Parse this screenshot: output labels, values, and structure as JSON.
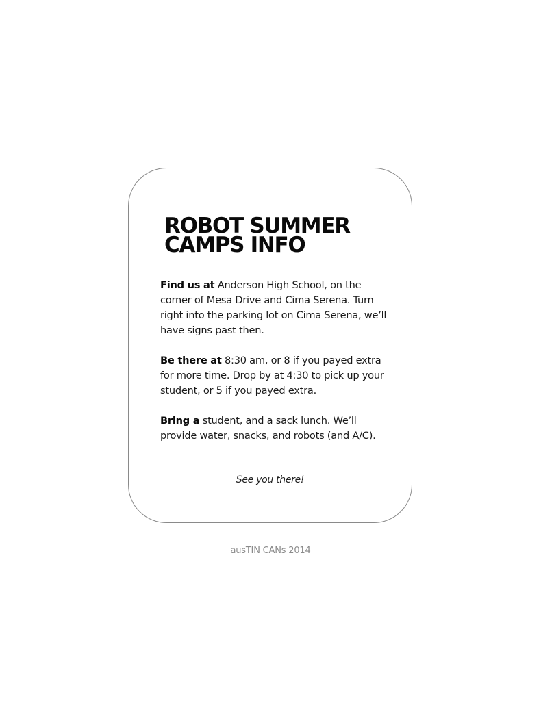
{
  "card": {
    "title_line1": "ROBOT SUMMER",
    "title_line2": "CAMPS INFO",
    "sections": [
      {
        "label": "Find us at",
        "text": " Anderson High School, on the corner of Mesa Drive and Cima Serena.  Turn right into the parking lot on Cima Serena, we’ll have signs past then."
      },
      {
        "label": "Be there at",
        "text": " 8:30 am, or 8 if you payed extra for more time. Drop by at 4:30 to pick up your student, or 5 if you payed extra."
      },
      {
        "label": "Bring a",
        "text": " student, and a sack lunch. We’ll provide water, snacks, and robots (and A/C)."
      }
    ],
    "signoff": "See you there!"
  },
  "footer": {
    "text": "ausTIN CANs 2014"
  }
}
